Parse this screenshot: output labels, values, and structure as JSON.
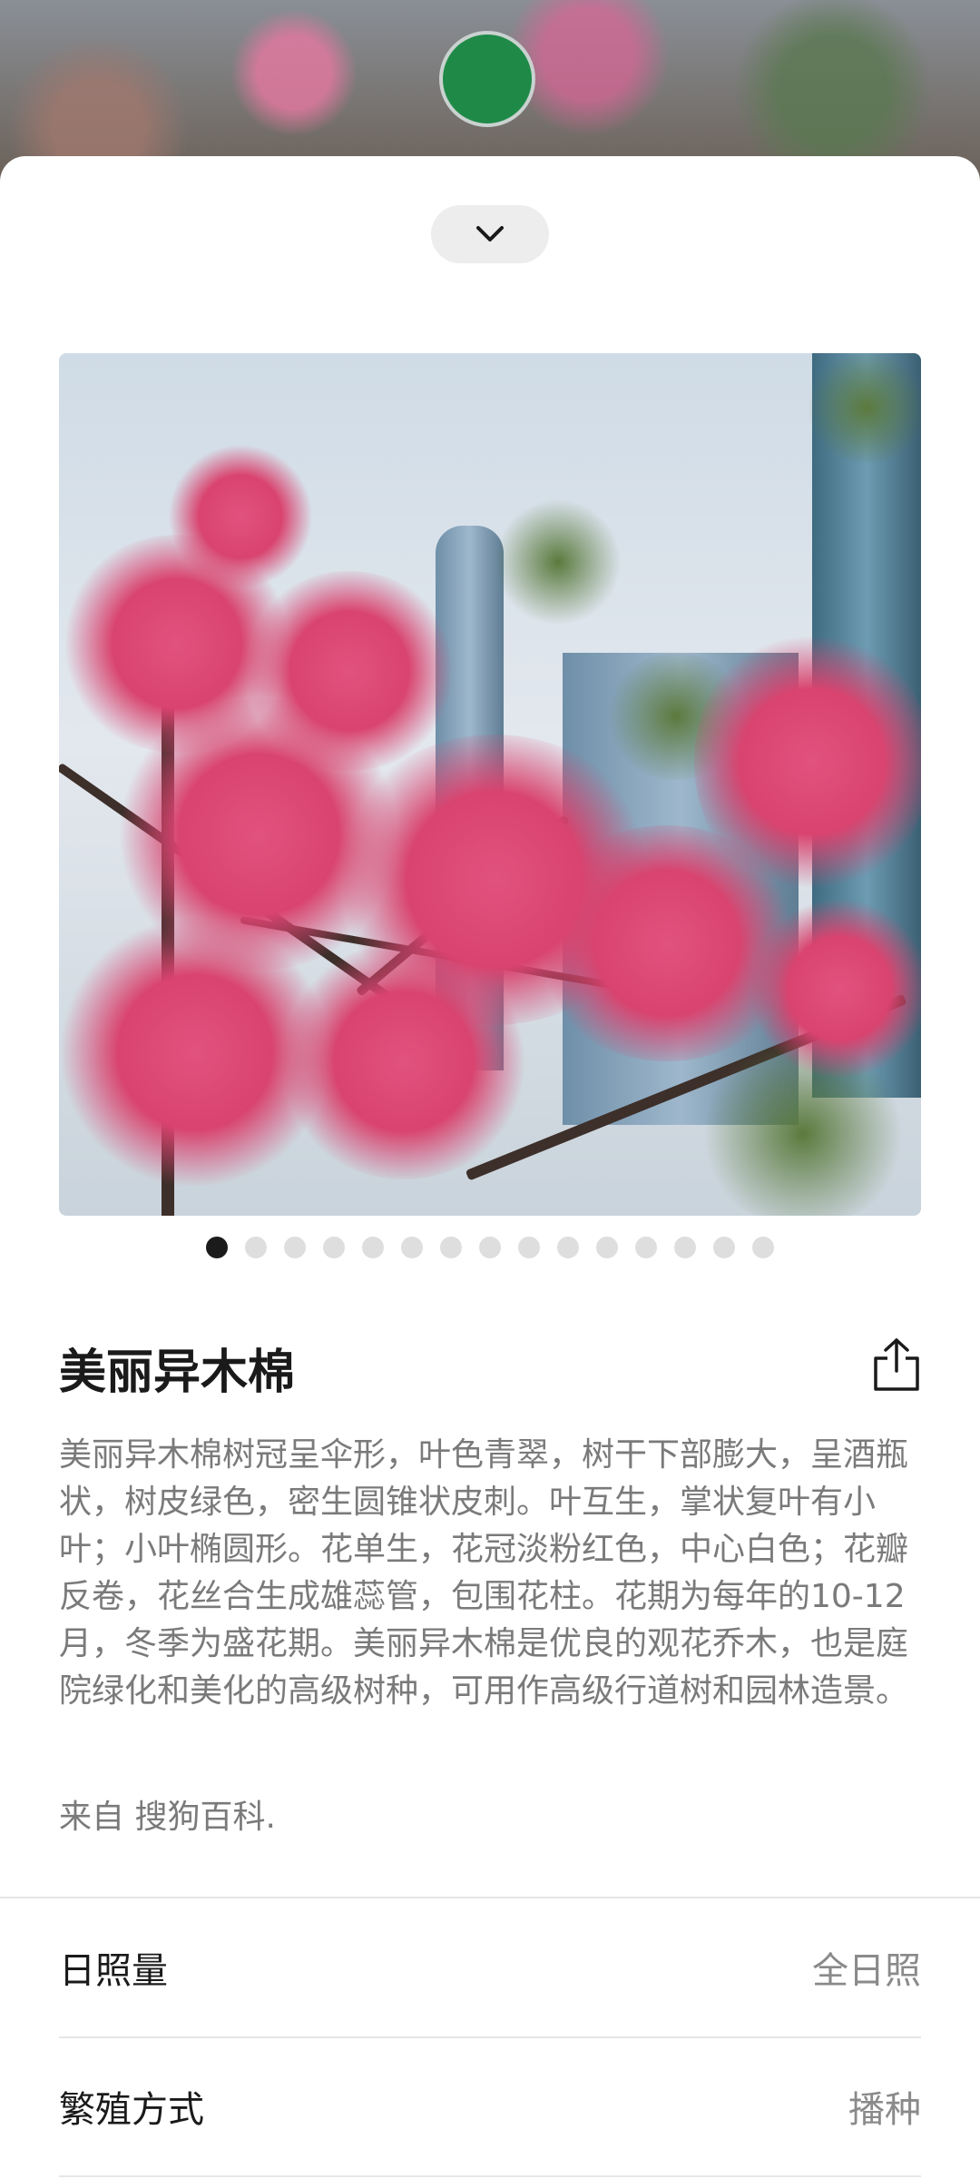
{
  "plant": {
    "name": "美丽异木棉",
    "description": "美丽异木棉树冠呈伞形，叶色青翠，树干下部膨大，呈酒瓶状，树皮绿色，密生圆锥状皮刺。叶互生，掌状复叶有小叶；小叶椭圆形。花单生，花冠淡粉红色，中心白色；花瓣反卷，花丝合生成雄蕊管，包围花柱。花期为每年的10-12月，冬季为盛花期。美丽异木棉是优良的观花乔木，也是庭院绿化和美化的高级树种，可用作高级行道树和园林造景。",
    "source": "来自 搜狗百科."
  },
  "gallery": {
    "total": 15,
    "active_index": 0
  },
  "attributes": [
    {
      "label": "日照量",
      "value": "全日照"
    },
    {
      "label": "繁殖方式",
      "value": "播种"
    }
  ],
  "icons": {
    "collapse": "chevron-down-icon",
    "share": "share-icon"
  },
  "colors": {
    "top_button": "#1f8a48",
    "active_dot": "#1b1b1b",
    "inactive_dot": "#dedede"
  }
}
